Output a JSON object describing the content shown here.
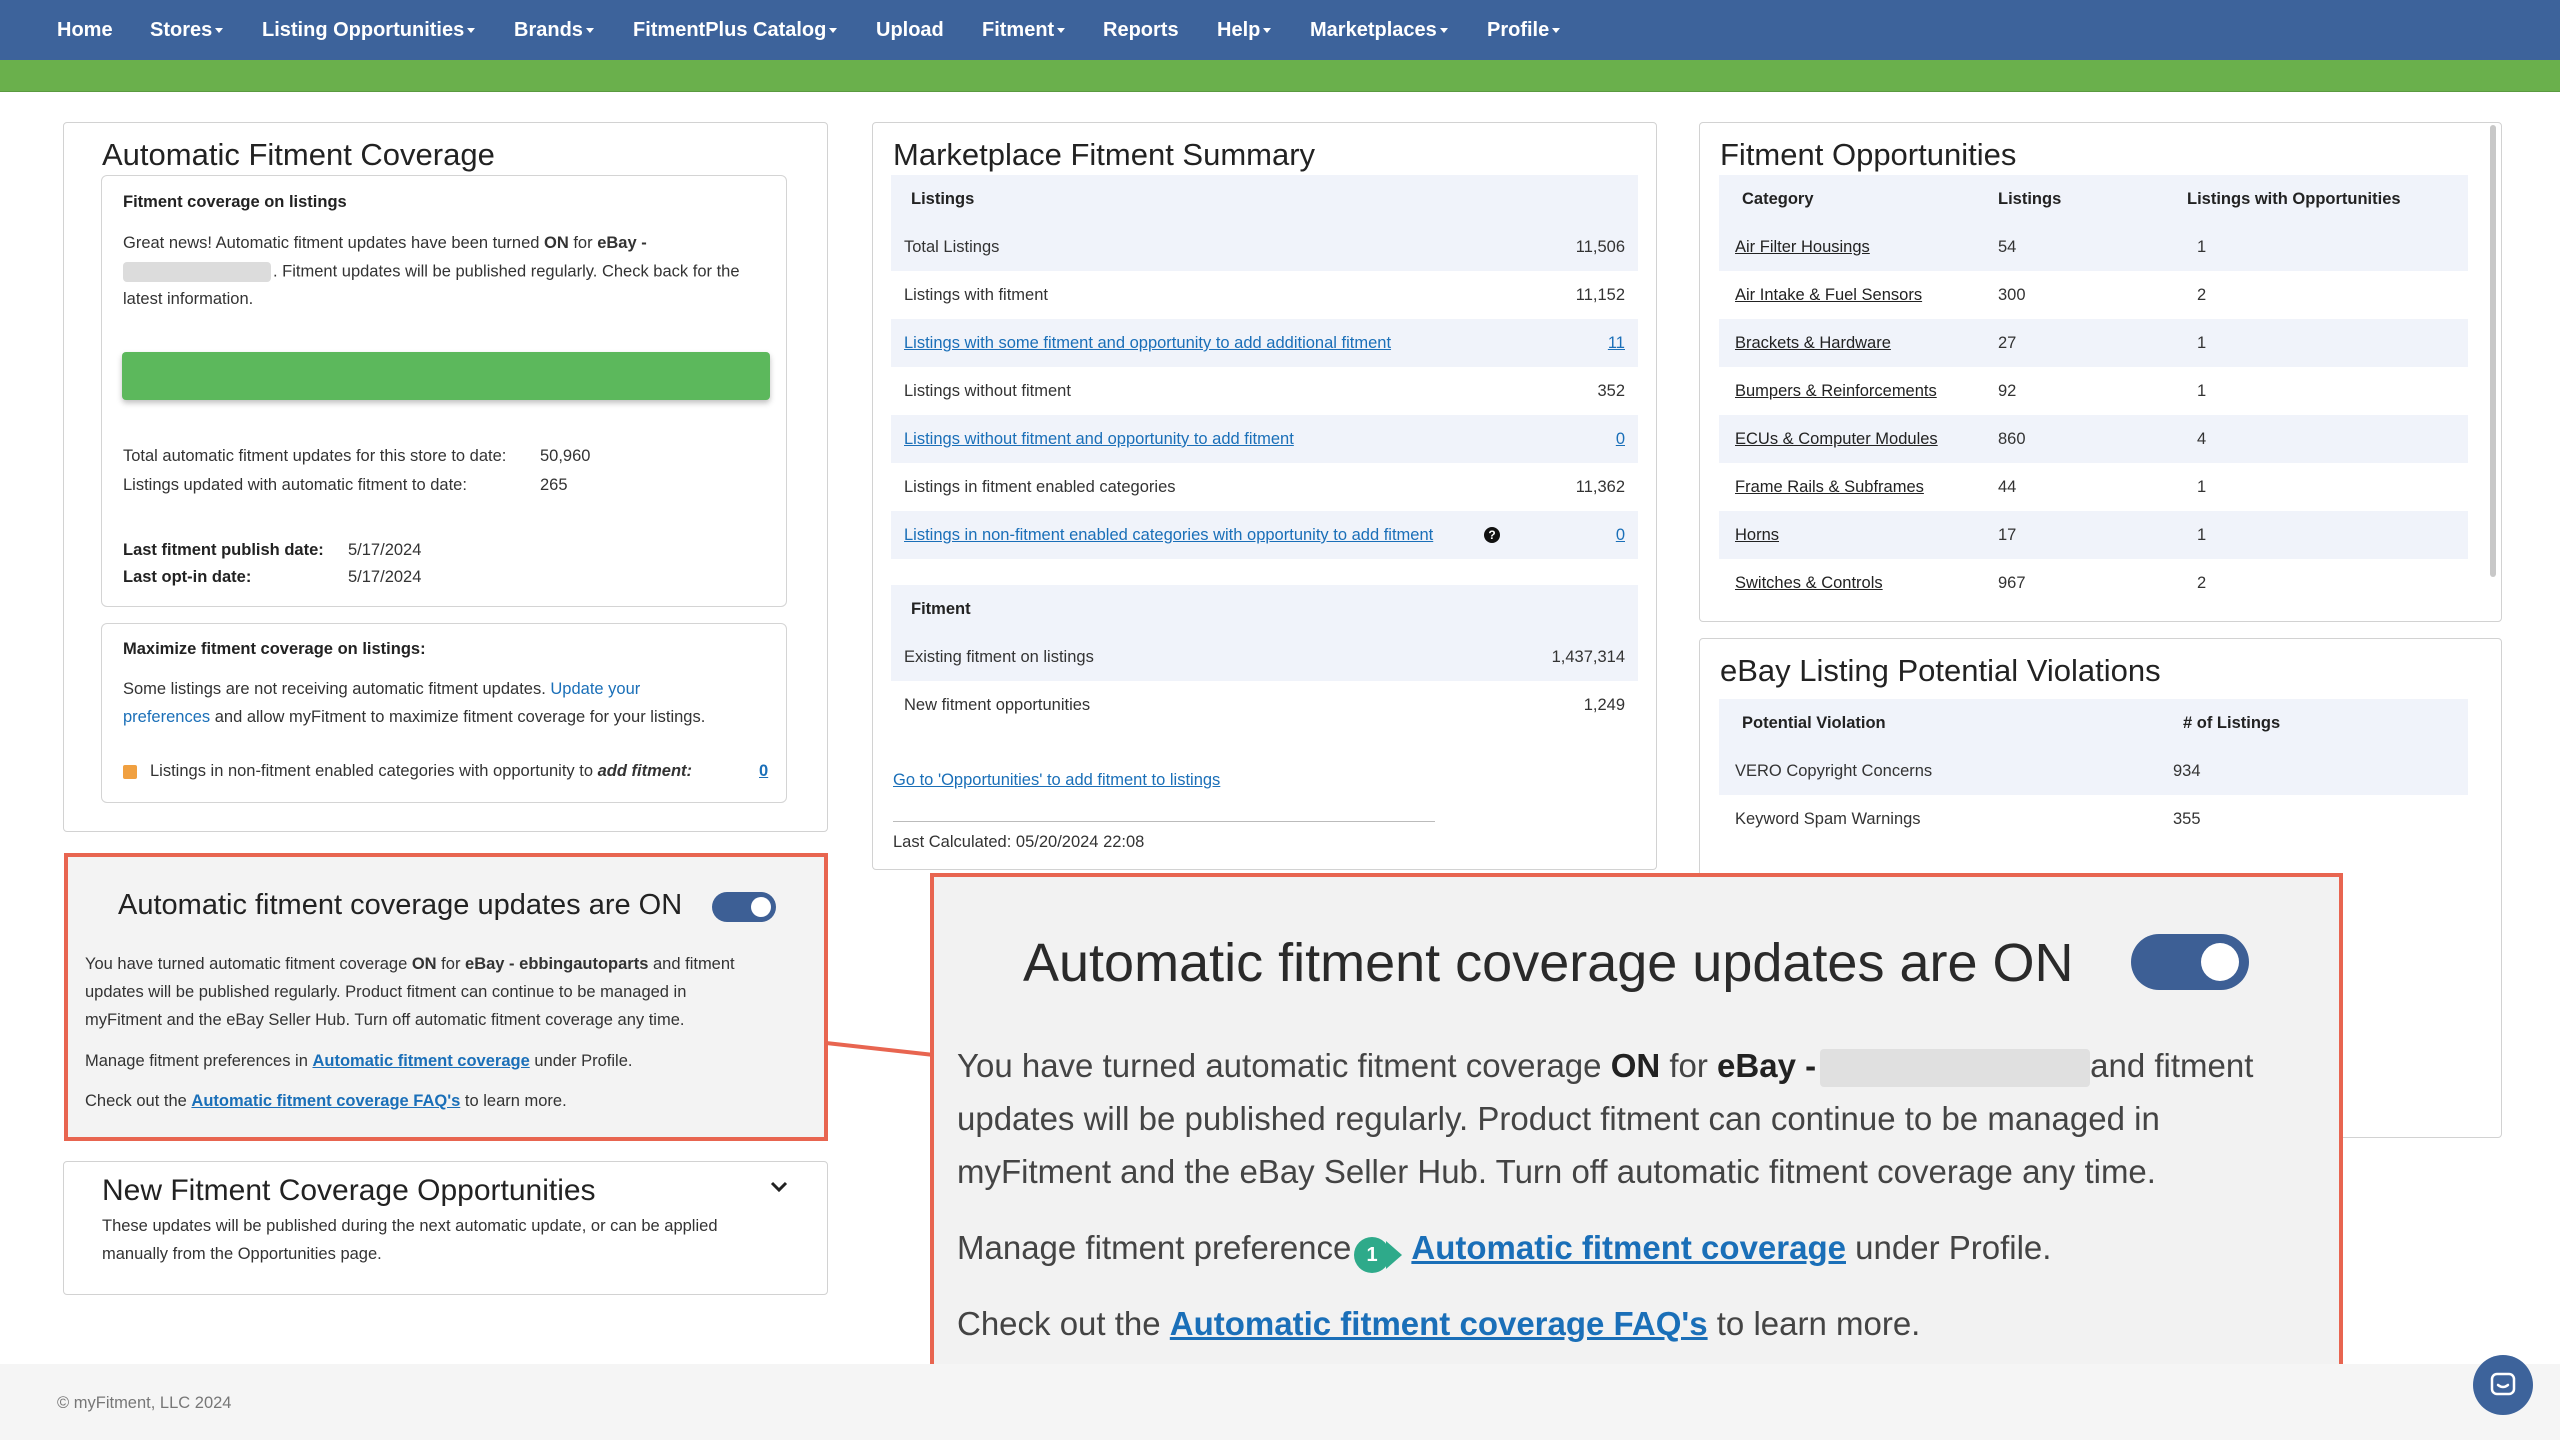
{
  "nav": {
    "items": [
      "Home",
      "Stores",
      "Listing Opportunities",
      "Brands",
      "FitmentPlus Catalog",
      "Upload",
      "Fitment",
      "Reports",
      "Help",
      "Marketplaces",
      "Profile"
    ]
  },
  "coverage": {
    "title": "Automatic Fitment Coverage",
    "box1_heading": "Fitment coverage on listings",
    "news_line1_a": "Great news! Automatic fitment updates have been turned ",
    "news_on": "ON",
    "news_line1_b": " for ",
    "news_store": "eBay -",
    "news_line2": ". Fitment updates will be published regularly. Check back for the",
    "news_line3": "latest information.",
    "total_label": "Total automatic fitment updates for this store to date:",
    "total_value": "50,960",
    "updated_label": "Listings updated with automatic fitment to date:",
    "updated_value": "265",
    "publish_label": "Last fitment publish date:",
    "publish_value": "5/17/2024",
    "optin_label": "Last opt-in date:",
    "optin_value": "5/17/2024",
    "box2_heading": "Maximize fitment coverage on listings:",
    "max_line1_a": "Some listings are not receiving automatic fitment updates. ",
    "max_link1": "Update your",
    "max_link2": "preferences",
    "max_line2_b": " and allow myFitment to maximize fitment coverage for your listings.",
    "legend_a": "Listings in non-fitment enabled categories with opportunity to ",
    "legend_b": "add fitment:",
    "legend_value": "0",
    "legend_color": "#f0a040"
  },
  "toggle_panel": {
    "title": "Automatic fitment coverage updates are ON",
    "p1_a": "You have turned automatic fitment coverage ",
    "p1_on": "ON",
    "p1_b": " for ",
    "p1_store": "eBay - ebbingautoparts",
    "p1_c": " and fitment",
    "p1_line2": "updates will be published regularly. Product fitment can continue to be managed in",
    "p1_line3": "myFitment and the eBay Seller Hub. Turn off automatic fitment coverage any time.",
    "p2_a": "Manage fitment preferences in ",
    "p2_link": "Automatic fitment coverage",
    "p2_b": " under Profile.",
    "p3_a": "Check out the ",
    "p3_link": "Automatic fitment coverage FAQ's",
    "p3_b": " to learn more."
  },
  "zoom": {
    "title": "Automatic fitment coverage updates are ON",
    "line1_a": "You have turned automatic fitment coverage ",
    "line1_on": "ON",
    "line1_b": " for ",
    "line1_store": "eBay -",
    "line1_c": "and fitment",
    "line2": "updates will be published regularly. Product fitment can continue to be managed in",
    "line3": "myFitment and the eBay Seller Hub. Turn off automatic fitment coverage any time.",
    "manage_a": "Manage fitment preference",
    "manage_link": "Automatic fitment coverage",
    "manage_b": " under Profile.",
    "check_a": "Check out the ",
    "check_link": "Automatic fitment coverage FAQ's",
    "check_b": " to learn more.",
    "step_badge": "1"
  },
  "new_opps": {
    "title": "New Fitment Coverage Opportunities",
    "line1": "These updates will be published during the next automatic update, or can be applied",
    "line2": "manually from the Opportunities page."
  },
  "summary": {
    "title": "Marketplace Fitment Summary",
    "listings_header": "Listings",
    "rows": [
      {
        "label": "Total Listings",
        "value": "11,506",
        "link": false
      },
      {
        "label": "Listings with fitment",
        "value": "11,152",
        "link": false
      },
      {
        "label": "Listings with some fitment and opportunity to add additional fitment",
        "value": "11",
        "link": true
      },
      {
        "label": "Listings without fitment",
        "value": "352",
        "link": false
      },
      {
        "label": "Listings without fitment and opportunity to add fitment",
        "value": "0",
        "link": true
      },
      {
        "label": "Listings in fitment enabled categories",
        "value": "11,362",
        "link": false
      },
      {
        "label": "Listings in non-fitment enabled categories with opportunity to add fitment",
        "value": "0",
        "link": true
      }
    ],
    "fitment_header": "Fitment",
    "fitment_rows": [
      {
        "label": "Existing fitment on listings",
        "value": "1,437,314"
      },
      {
        "label": "New fitment opportunities",
        "value": "1,249"
      }
    ],
    "go_link": "Go to 'Opportunities' to add fitment to listings",
    "last_calc": "Last Calculated: 05/20/2024 22:08"
  },
  "opportunities": {
    "title": "Fitment Opportunities",
    "headers": [
      "Category",
      "Listings",
      "Listings with Opportunities"
    ],
    "rows": [
      [
        "Air Filter Housings",
        "54",
        "1"
      ],
      [
        "Air Intake & Fuel Sensors",
        "300",
        "2"
      ],
      [
        "Brackets & Hardware",
        "27",
        "1"
      ],
      [
        "Bumpers & Reinforcements",
        "92",
        "1"
      ],
      [
        "ECUs & Computer Modules",
        "860",
        "4"
      ],
      [
        "Frame Rails & Subframes",
        "44",
        "1"
      ],
      [
        "Horns",
        "17",
        "1"
      ],
      [
        "Switches & Controls",
        "967",
        "2"
      ]
    ]
  },
  "violations": {
    "title": "eBay Listing Potential Violations",
    "headers": [
      "Potential Violation",
      "# of Listings"
    ],
    "rows": [
      [
        "VERO Copyright Concerns",
        "934"
      ],
      [
        "Keyword Spam Warnings",
        "355"
      ]
    ]
  },
  "footer": {
    "copyright": "© myFitment, LLC 2024"
  },
  "colors": {
    "nav_bg": "#3d639b",
    "green_bar": "#6ab04c",
    "highlight_border": "#e86550",
    "toggle_on": "#3d5f95",
    "step_badge": "#2eaa8a"
  }
}
